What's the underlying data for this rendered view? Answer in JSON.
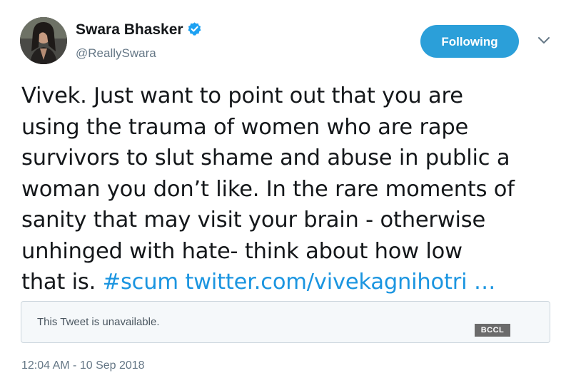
{
  "author": {
    "display_name": "Swara Bhasker",
    "handle": "@ReallySwara",
    "verified": true
  },
  "follow_button": {
    "label": "Following"
  },
  "menu_icon": "chevron-down-icon",
  "tweet": {
    "lines": [
      "Vivek. Just want to point out that you are",
      "using the trauma of women who are rape",
      "survivors to slut shame and abuse in public a",
      "woman you don’t like. In the rare moments of",
      "sanity that may visit your brain - otherwise",
      "unhinged with hate- think about how low",
      "that is."
    ],
    "hashtag": "#scum",
    "link": "twitter.com/vivekagnihotri …"
  },
  "quoted_tweet": {
    "text": "This Tweet is unavailable."
  },
  "watermark": "BCCL",
  "timestamp": "12:04 AM - 10 Sep 2018",
  "colors": {
    "accent": "#2b9fd9",
    "link": "#1b95e0",
    "text": "#14171a",
    "secondary": "#657786"
  }
}
